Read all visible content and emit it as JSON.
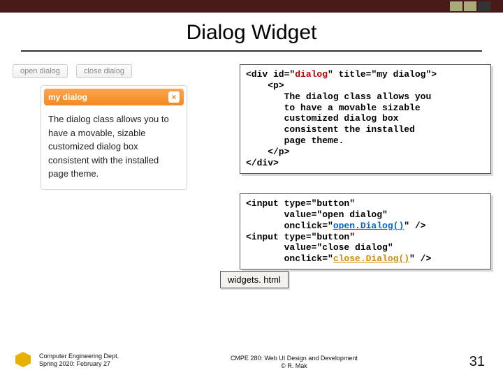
{
  "title": "Dialog Widget",
  "demo": {
    "open_btn": "open dialog",
    "close_btn": "close dialog",
    "dialog_title": "my dialog",
    "dialog_body": "The dialog class allows you to have a movable, sizable customized dialog box consistent with the installed page theme."
  },
  "code1": {
    "l1a": "<div id=\"",
    "l1b": "dialog",
    "l1c": "\" title=\"my dialog\">",
    "l2": "    <p>",
    "l3": "       The dialog class allows you",
    "l4": "       to have a movable sizable",
    "l5": "       customized dialog box",
    "l6": "       consistent the installed",
    "l7": "       page theme.",
    "l8": "    </p>",
    "l9": "</div>"
  },
  "code2": {
    "l1": "<input type=\"button\"",
    "l2": "       value=\"open dialog\"",
    "l3a": "       onclick=\"",
    "l3b": "open.Dialog()",
    "l3c": "\" />",
    "l4": "<input type=\"button\"",
    "l5": "       value=\"close dialog\"",
    "l6a": "       onclick=\"",
    "l6b": "close.Dialog()",
    "l6c": "\" />"
  },
  "file_label": "widgets. html",
  "footer": {
    "left1": "Computer Engineering Dept.",
    "left2": "Spring 2020: February 27",
    "center1": "CMPE 280: Web UI Design and Development",
    "center2": "© R. Mak",
    "page": "31"
  }
}
